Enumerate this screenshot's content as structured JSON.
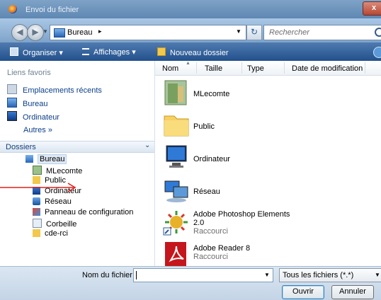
{
  "window": {
    "title": "Envoi du fichier",
    "close_symbol": "x"
  },
  "address": {
    "location": "Bureau",
    "separator": "▸",
    "search_placeholder": "Rechercher"
  },
  "toolbar": {
    "organize": "Organiser ▾",
    "views": "Affichages ▾",
    "new_folder": "Nouveau dossier"
  },
  "favorites": {
    "title": "Liens favoris",
    "items": [
      "Emplacements récents",
      "Bureau",
      "Ordinateur"
    ],
    "more": "Autres »"
  },
  "folders": {
    "title": "Dossiers",
    "tree": [
      "Bureau",
      "MLecomte",
      "Public",
      "Ordinateur",
      "Réseau",
      "Panneau de configuration",
      "Corbeille",
      "cde-rci"
    ]
  },
  "columns": [
    "Nom",
    "Taille",
    "Type",
    "Date de modification"
  ],
  "files": [
    {
      "name": "MLecomte",
      "sub": ""
    },
    {
      "name": "Public",
      "sub": ""
    },
    {
      "name": "Ordinateur",
      "sub": ""
    },
    {
      "name": "Réseau",
      "sub": ""
    },
    {
      "name": "Adobe Photoshop Elements",
      "name2": "2.0",
      "sub": "Raccourci"
    },
    {
      "name": "Adobe Reader 8",
      "sub": "Raccourci"
    }
  ],
  "footer": {
    "filename_label": "Nom du fichier :",
    "filename_value": "",
    "filetype": "Tous les fichiers (*.*)",
    "open": "Ouvrir",
    "cancel": "Annuler"
  }
}
